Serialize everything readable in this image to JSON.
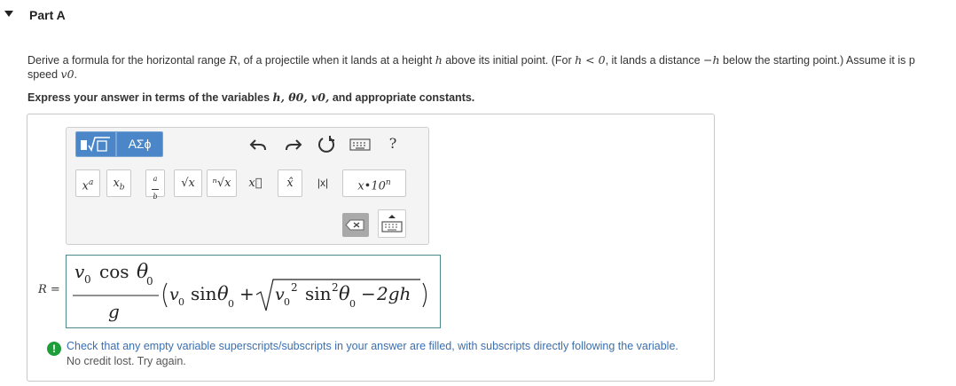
{
  "part": {
    "title": "Part A"
  },
  "question": {
    "line1_a": "Derive a formula for the horizontal range ",
    "var_R": "R",
    "line1_b": ", of a projectile when it lands at a height ",
    "var_h": "h",
    "line1_c": " above its initial point. (For ",
    "cond": "h < 0",
    "line1_d": ", it lands a distance ",
    "neg_h": "−h",
    "line1_e": " below the starting point.) Assume it is p",
    "line2_a": "speed ",
    "var_v0": "v0",
    "line2_b": "."
  },
  "instruction": {
    "a": "Express your answer in terms of the variables ",
    "vars": "h, θ0, v0,",
    "b": " and appropriate constants."
  },
  "toolbar": {
    "templates_icon": "template-sqrt-icon",
    "greek_label": "ΑΣϕ",
    "undo_icon": "undo-icon",
    "redo_icon": "redo-icon",
    "reset_icon": "reset-icon",
    "keyboard_icon": "keyboard-icon",
    "help_label": "?",
    "buttons": {
      "superscript": "x^a",
      "subscript": "x_b",
      "fraction": "a/b",
      "sqrt": "√x",
      "nthroot": "ⁿ√x",
      "vector": "x⃗",
      "unitvector": "x̂",
      "abs": "|x|",
      "scinot_a": "x•10",
      "scinot_b": "n"
    }
  },
  "answer": {
    "label": "R =",
    "numerator_v": "v",
    "sub0": "0",
    "cos": "cos",
    "theta": "θ",
    "denominator": "g",
    "sin": "sin",
    "plus": "+",
    "sq": "2",
    "minus": "−",
    "twogh": "2gh"
  },
  "feedback": {
    "icon": "!",
    "main": "Check that any empty variable superscripts/subscripts in your answer are filled, with subscripts directly following the variable.",
    "sub": "No credit lost. Try again."
  }
}
